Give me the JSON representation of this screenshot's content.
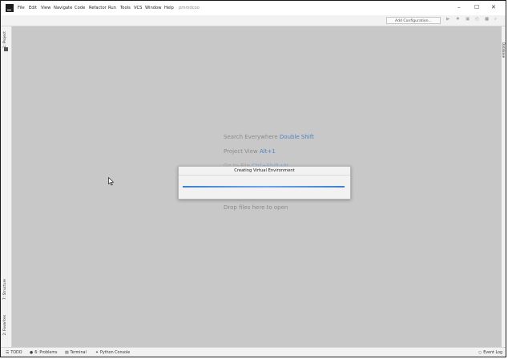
{
  "menu": {
    "items": [
      "File",
      "Edit",
      "View",
      "Navigate",
      "Code",
      "Refactor",
      "Run",
      "Tools",
      "VCS",
      "Window",
      "Help"
    ],
    "project_name": "pmmdcoo"
  },
  "window_controls": {
    "minimize": "–",
    "maximize": "☐",
    "close": "✕"
  },
  "toolbar": {
    "add_configuration": "Add Configuration..."
  },
  "left_tabs": {
    "project": "1: Project",
    "structure": "7: Structure",
    "favorites": "2: Favorites"
  },
  "right_tabs": {
    "database": "Database"
  },
  "editor_hints": {
    "search_everywhere": {
      "text": "Search Everywhere ",
      "key": "Double Shift"
    },
    "project_view": {
      "text": "Project View ",
      "key": "Alt+1"
    },
    "go_to_file": {
      "text": "Go to File ",
      "key": "Ctrl+Shift+N"
    },
    "drop_files": "Drop files here to open"
  },
  "dialog": {
    "title": "Creating Virtual Environment",
    "progress": 1.0
  },
  "statusbar": {
    "todo": "TODO",
    "problems": "6: Problems",
    "terminal": "Terminal",
    "python_console": "Python Console",
    "event_log": "Event Log"
  },
  "colors": {
    "editor_bg": "#c8c8c8",
    "accent": "#4e82c4",
    "progress": "#3d7fd0"
  }
}
